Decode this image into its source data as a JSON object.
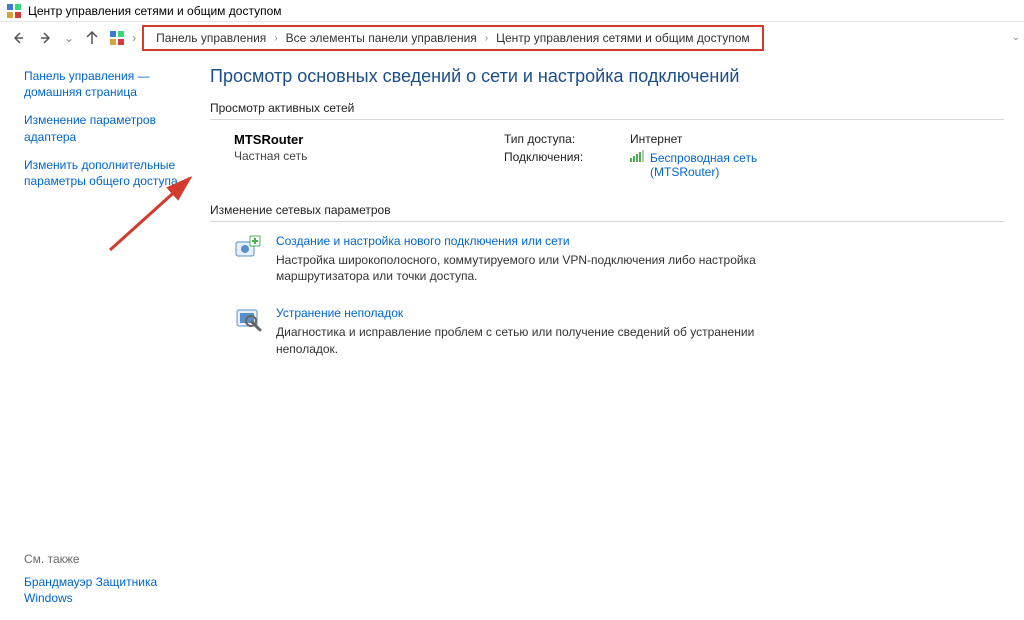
{
  "window": {
    "title": "Центр управления сетями и общим доступом"
  },
  "breadcrumb": {
    "items": [
      "Панель управления",
      "Все элементы панели управления",
      "Центр управления сетями и общим доступом"
    ]
  },
  "sidebar": {
    "links": [
      "Панель управления — домашняя страница",
      "Изменение параметров адаптера",
      "Изменить дополнительные параметры общего доступа"
    ],
    "see_also_label": "См. также",
    "firewall_link": "Брандмауэр Защитника Windows"
  },
  "main": {
    "heading": "Просмотр основных сведений о сети и настройка подключений",
    "active_section_title": "Просмотр активных сетей",
    "network": {
      "name": "MTSRouter",
      "type": "Частная сеть",
      "access_label": "Тип доступа:",
      "access_value": "Интернет",
      "connections_label": "Подключения:",
      "connection_link": "Беспроводная сеть",
      "connection_sub": "(MTSRouter)"
    },
    "change_section_title": "Изменение сетевых параметров",
    "tasks": [
      {
        "title": "Создание и настройка нового подключения или сети",
        "desc": "Настройка широкополосного, коммутируемого или VPN-подключения либо настройка маршрутизатора или точки доступа."
      },
      {
        "title": "Устранение неполадок",
        "desc": "Диагностика и исправление проблем с сетью или получение сведений об устранении неполадок."
      }
    ]
  }
}
